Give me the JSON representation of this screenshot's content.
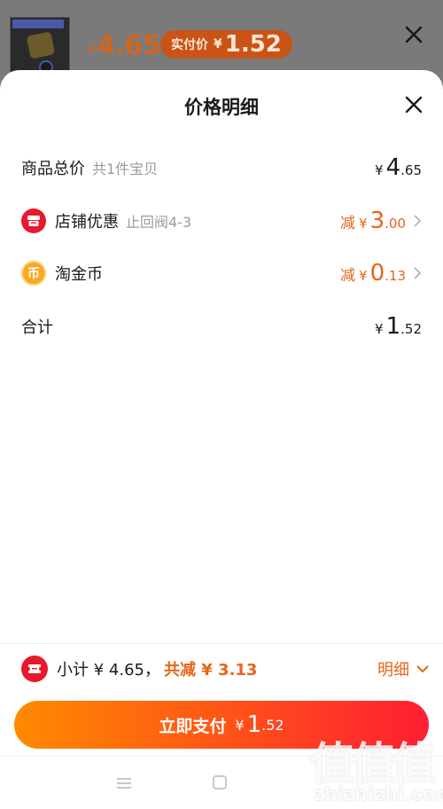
{
  "top_bar": {
    "price_currency": "¥",
    "price": "4.65",
    "badge_label": "实付价",
    "badge_currency": "¥",
    "badge_value": "1.52"
  },
  "sheet": {
    "title": "价格明细",
    "rows": [
      {
        "label": "商品总价",
        "sub": "共1件宝贝",
        "prefix": "",
        "currency": "¥",
        "int": "4",
        "dec": ".65",
        "clickable": false
      },
      {
        "icon": "shop-icon",
        "label": "店铺优惠",
        "sub": "止回阀4-3",
        "prefix": "减",
        "currency": "¥",
        "int": "3",
        "dec": ".00",
        "clickable": true
      },
      {
        "icon": "coin-icon",
        "icon_text": "币",
        "label": "淘金币",
        "sub": "",
        "prefix": "减",
        "currency": "¥",
        "int": "0",
        "dec": ".13",
        "clickable": true
      },
      {
        "label": "合计",
        "sub": "",
        "prefix": "",
        "currency": "¥",
        "int": "1",
        "dec": ".52",
        "clickable": false
      }
    ]
  },
  "summary": {
    "text": "小计 ¥ 4.65，",
    "discount": "共减 ¥ 3.13",
    "detail_label": "明细"
  },
  "pay_button": {
    "label": "立即支付",
    "currency": "¥",
    "int": "1",
    "dec": ".52"
  },
  "watermark": {
    "chars": "值值值",
    "url": "zhizhizhi.com"
  },
  "colors": {
    "accent": "#e8651a",
    "shop_icon": "#e8192c",
    "coin_icon": "#f9a825",
    "button_start": "#ff8a00",
    "button_end": "#ff1e32"
  }
}
